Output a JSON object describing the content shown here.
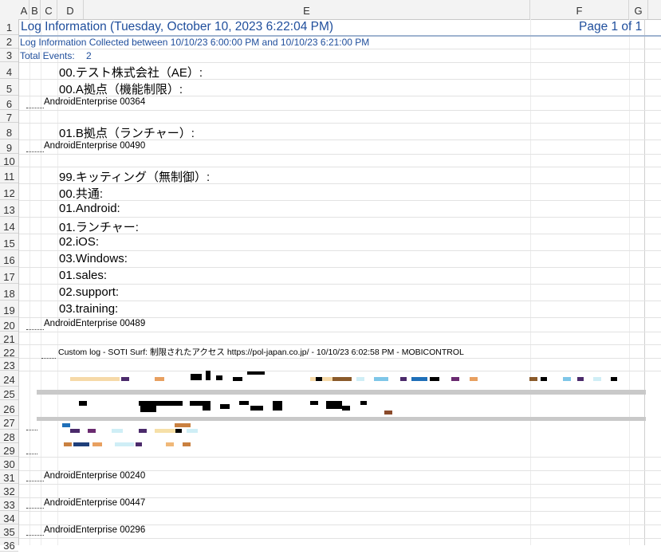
{
  "columns": [
    "A",
    "B",
    "C",
    "D",
    "E",
    "F",
    "G"
  ],
  "rows": [
    "1",
    "2",
    "3",
    "4",
    "5",
    "6",
    "7",
    "8",
    "9",
    "10",
    "11",
    "12",
    "13",
    "14",
    "15",
    "16",
    "17",
    "18",
    "19",
    "20",
    "21",
    "22",
    "23",
    "24",
    "25",
    "26",
    "27",
    "28",
    "29",
    "30",
    "31",
    "32",
    "33",
    "34",
    "35",
    "36"
  ],
  "header": {
    "title": "Log Information  (Tuesday, October 10, 2023 6:22:04 PM)",
    "page": "Page 1 of 1",
    "collected": "Log Information Collected between 10/10/23  6:00:00 PM and 10/10/23  6:21:00 PM",
    "total_label": "Total Events:",
    "total_value": "2"
  },
  "tree": [
    "00.テスト株式会社（AE）:",
    "00.A拠点（機能制限）:",
    "01.B拠点（ランチャー）:",
    "99.キッティング（無制御）:",
    "00.共通:",
    "01.Android:",
    "01.ランチャー:",
    "02.iOS:",
    "03.Windows:",
    "01.sales:",
    "02.support:",
    "03.training:"
  ],
  "devices": [
    "AndroidEnterprise 00364",
    "AndroidEnterprise 00490",
    "AndroidEnterprise 00489",
    "AndroidEnterprise 00240",
    "AndroidEnterprise 00447",
    "AndroidEnterprise 00296"
  ],
  "log_entry": "Custom log  - SOTI Surf: 制限されたアクセス https://pol-japan.co.jp/ - 10/10/23  6:02:58 PM  - MOBICONTROL"
}
